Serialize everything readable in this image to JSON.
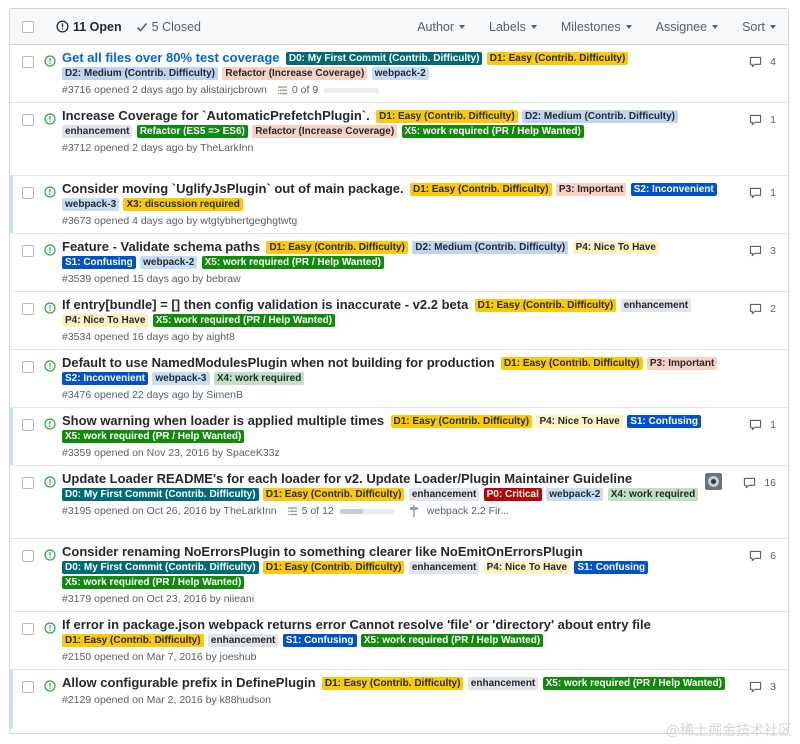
{
  "header": {
    "open_count": "11 Open",
    "closed_count": "5 Closed",
    "filters": [
      "Author",
      "Labels",
      "Milestones",
      "Assignee",
      "Sort"
    ]
  },
  "issues": [
    {
      "title": "Get all files over 80% test coverage",
      "highlight_title": true,
      "labels": [
        {
          "name": "D0: My First Commit (Contrib. Difficulty)",
          "bg": "#006b75",
          "fg": "#ffffff"
        },
        {
          "name": "D1: Easy (Contrib. Difficulty)",
          "bg": "#fbca04",
          "fg": "#24292e"
        },
        {
          "name": "D2: Medium (Contrib. Difficulty)",
          "bg": "#bfd4f2",
          "fg": "#24292e"
        },
        {
          "name": "Refactor (Increase Coverage)",
          "bg": "#f9d0c4",
          "fg": "#24292e"
        },
        {
          "name": "webpack-2",
          "bg": "#c5def5",
          "fg": "#24292e"
        }
      ],
      "meta": "#3716 opened 2 days ago by alistairjcbrown",
      "progress_text": "0 of 9",
      "progress": 0.0,
      "comments": "4",
      "row_highlight": false
    },
    {
      "title": "Increase Coverage for `AutomaticPrefetchPlugin`.",
      "labels": [
        {
          "name": "D1: Easy (Contrib. Difficulty)",
          "bg": "#fbca04",
          "fg": "#24292e"
        },
        {
          "name": "D2: Medium (Contrib. Difficulty)",
          "bg": "#bfd4f2",
          "fg": "#24292e"
        },
        {
          "name": "enhancement",
          "bg": "#e1e4e8",
          "fg": "#24292e"
        },
        {
          "name": "Refactor (ES5 => ES6)",
          "bg": "#0e8a16",
          "fg": "#ffffff"
        },
        {
          "name": "Refactor (Increase Coverage)",
          "bg": "#f9d0c4",
          "fg": "#24292e"
        },
        {
          "name": "X5: work required (PR / Help Wanted)",
          "bg": "#128a0c",
          "fg": "#ffffff"
        }
      ],
      "meta": "#3712 opened 2 days ago by TheLarkInn",
      "comments": "1",
      "row_highlight": false
    },
    {
      "title": "Consider moving `UglifyJsPlugin` out of main package.",
      "labels": [
        {
          "name": "D1: Easy (Contrib. Difficulty)",
          "bg": "#fbca04",
          "fg": "#24292e"
        },
        {
          "name": "P3: Important",
          "bg": "#f9d0c4",
          "fg": "#24292e"
        },
        {
          "name": "S2: Inconvenient",
          "bg": "#0052cc",
          "fg": "#ffffff"
        },
        {
          "name": "webpack-3",
          "bg": "#c5def5",
          "fg": "#24292e"
        },
        {
          "name": "X3: discussion required",
          "bg": "#fbca04",
          "fg": "#24292e"
        }
      ],
      "meta": "#3673 opened 4 days ago by wtgtybhertgeghgtwtg",
      "comments": "1",
      "row_highlight": true
    },
    {
      "title": "Feature - Validate schema paths",
      "labels": [
        {
          "name": "D1: Easy (Contrib. Difficulty)",
          "bg": "#fbca04",
          "fg": "#24292e"
        },
        {
          "name": "D2: Medium (Contrib. Difficulty)",
          "bg": "#bfd4f2",
          "fg": "#24292e"
        },
        {
          "name": "P4: Nice To Have",
          "bg": "#fef2c0",
          "fg": "#24292e"
        },
        {
          "name": "S1: Confusing",
          "bg": "#0052cc",
          "fg": "#ffffff"
        },
        {
          "name": "webpack-2",
          "bg": "#c5def5",
          "fg": "#24292e"
        },
        {
          "name": "X5: work required (PR / Help Wanted)",
          "bg": "#128a0c",
          "fg": "#ffffff"
        }
      ],
      "meta": "#3539 opened 15 days ago by bebraw",
      "comments": "3",
      "row_highlight": false
    },
    {
      "title": "If entry[bundle] = [] then config validation is inaccurate - v2.2 beta",
      "labels": [
        {
          "name": "D1: Easy (Contrib. Difficulty)",
          "bg": "#fbca04",
          "fg": "#24292e"
        },
        {
          "name": "enhancement",
          "bg": "#e1e4e8",
          "fg": "#24292e"
        },
        {
          "name": "P4: Nice To Have",
          "bg": "#fef2c0",
          "fg": "#24292e"
        },
        {
          "name": "X5: work required (PR / Help Wanted)",
          "bg": "#128a0c",
          "fg": "#ffffff"
        }
      ],
      "meta": "#3534 opened 16 days ago by aight8",
      "comments": "2",
      "row_highlight": false
    },
    {
      "title": "Default to use NamedModulesPlugin when not building for production",
      "labels": [
        {
          "name": "D1: Easy (Contrib. Difficulty)",
          "bg": "#fbca04",
          "fg": "#24292e"
        },
        {
          "name": "P3: Important",
          "bg": "#f9d0c4",
          "fg": "#24292e"
        },
        {
          "name": "S2: Inconvenient",
          "bg": "#0052cc",
          "fg": "#ffffff"
        },
        {
          "name": "webpack-3",
          "bg": "#c5def5",
          "fg": "#24292e"
        },
        {
          "name": "X4: work required",
          "bg": "#c2e0c6",
          "fg": "#24292e"
        }
      ],
      "meta": "#3476 opened 22 days ago by SimenB",
      "comments": "",
      "row_highlight": false
    },
    {
      "title": "Show warning when loader is applied multiple times",
      "labels": [
        {
          "name": "D1: Easy (Contrib. Difficulty)",
          "bg": "#fbca04",
          "fg": "#24292e"
        },
        {
          "name": "P4: Nice To Have",
          "bg": "#fef2c0",
          "fg": "#24292e"
        },
        {
          "name": "S1: Confusing",
          "bg": "#0052cc",
          "fg": "#ffffff"
        },
        {
          "name": "X5: work required (PR / Help Wanted)",
          "bg": "#128a0c",
          "fg": "#ffffff"
        }
      ],
      "meta": "#3359 opened on Nov 23, 2016 by SpaceK33z",
      "comments": "1",
      "row_highlight": true
    },
    {
      "title": "Update Loader README's for each loader for v2. Update Loader/Plugin Maintainer Guideline",
      "labels": [
        {
          "name": "D0: My First Commit (Contrib. Difficulty)",
          "bg": "#006b75",
          "fg": "#ffffff"
        },
        {
          "name": "D1: Easy (Contrib. Difficulty)",
          "bg": "#fbca04",
          "fg": "#24292e"
        },
        {
          "name": "enhancement",
          "bg": "#e1e4e8",
          "fg": "#24292e"
        },
        {
          "name": "P0: Critical",
          "bg": "#b60205",
          "fg": "#ffffff"
        },
        {
          "name": "webpack-2",
          "bg": "#c5def5",
          "fg": "#24292e"
        },
        {
          "name": "X4: work required",
          "bg": "#c2e0c6",
          "fg": "#24292e"
        }
      ],
      "meta": "#3195 opened on Oct 26, 2016 by TheLarkInn",
      "progress_text": "5 of 12",
      "progress": 0.42,
      "milestone": "webpack 2.2 Fir...",
      "comments": "16",
      "has_avatar": true,
      "row_highlight": false
    },
    {
      "title": "Consider renaming NoErrorsPlugin to something clearer like NoEmitOnErrorsPlugin",
      "labels": [
        {
          "name": "D0: My First Commit (Contrib. Difficulty)",
          "bg": "#006b75",
          "fg": "#ffffff"
        },
        {
          "name": "D1: Easy (Contrib. Difficulty)",
          "bg": "#fbca04",
          "fg": "#24292e"
        },
        {
          "name": "enhancement",
          "bg": "#e1e4e8",
          "fg": "#24292e"
        },
        {
          "name": "P4: Nice To Have",
          "bg": "#fef2c0",
          "fg": "#24292e"
        },
        {
          "name": "S1: Confusing",
          "bg": "#0052cc",
          "fg": "#ffffff"
        },
        {
          "name": "X5: work required (PR / Help Wanted)",
          "bg": "#128a0c",
          "fg": "#ffffff"
        }
      ],
      "meta": "#3179 opened on Oct 23, 2016 by niieani",
      "comments": "6",
      "row_highlight": false
    },
    {
      "title": "If error in package.json webpack returns error Cannot resolve 'file' or 'directory' about entry file",
      "labels": [
        {
          "name": "D1: Easy (Contrib. Difficulty)",
          "bg": "#fbca04",
          "fg": "#24292e"
        },
        {
          "name": "enhancement",
          "bg": "#e1e4e8",
          "fg": "#24292e"
        },
        {
          "name": "S1: Confusing",
          "bg": "#0052cc",
          "fg": "#ffffff"
        },
        {
          "name": "X5: work required (PR / Help Wanted)",
          "bg": "#128a0c",
          "fg": "#ffffff"
        }
      ],
      "meta": "#2150 opened on Mar 7, 2016 by joeshub",
      "comments": "",
      "row_highlight": false
    },
    {
      "title": "Allow configurable prefix in DefinePlugin",
      "labels": [
        {
          "name": "D1: Easy (Contrib. Difficulty)",
          "bg": "#fbca04",
          "fg": "#24292e"
        },
        {
          "name": "enhancement",
          "bg": "#e1e4e8",
          "fg": "#24292e"
        },
        {
          "name": "X5: work required (PR / Help Wanted)",
          "bg": "#128a0c",
          "fg": "#ffffff"
        }
      ],
      "meta": "#2129 opened on Mar 2, 2016 by k88hudson",
      "comments": "3",
      "row_highlight": true
    }
  ],
  "watermark": "@稀土掘金技术社区",
  "icons": {
    "open": "issue-opened-icon",
    "closed": "check-icon",
    "comment": "comment-icon",
    "tasks": "tasklist-icon",
    "milestone": "milestone-icon"
  },
  "colors": {
    "open_green": "#28a745",
    "link_blue": "#0366d6",
    "row_highlight": "#c8e1ff"
  }
}
